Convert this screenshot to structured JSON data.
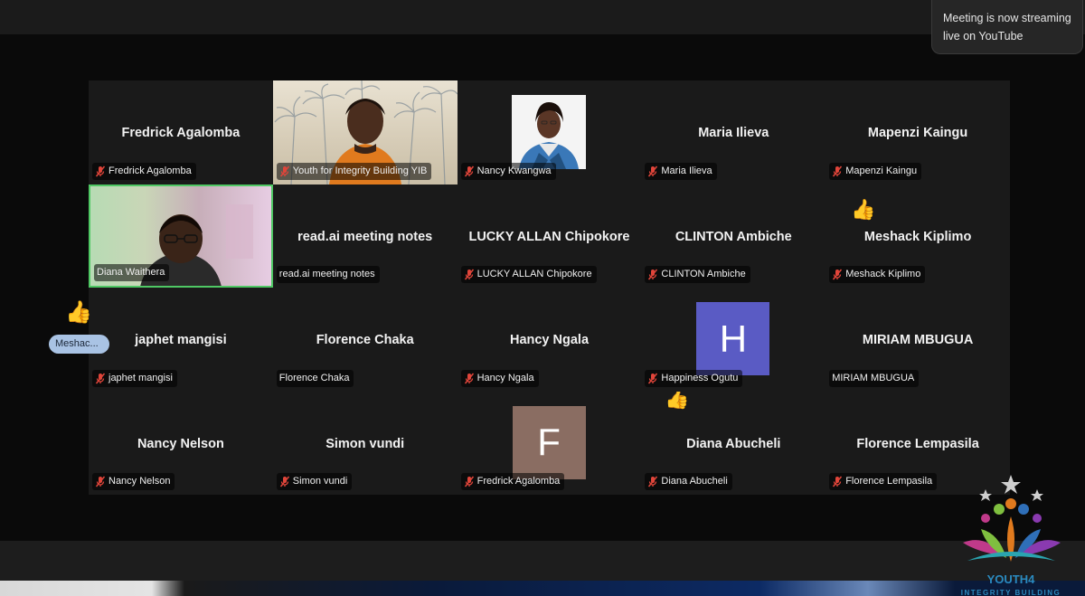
{
  "toast": {
    "line1": "Meeting is now streaming",
    "line2": "live on YouTube"
  },
  "side_participant": {
    "reaction": "👍",
    "name": "Meshac..."
  },
  "tiles": [
    {
      "center": "Fredrick Agalomba",
      "label": "Fredrick Agalomba",
      "muted": true
    },
    {
      "center": "",
      "label": "Youth for Integrity Building YIB",
      "muted": true,
      "video": "youth"
    },
    {
      "center": "",
      "label": "Nancy Kwangwa",
      "muted": true,
      "avatar": "photo"
    },
    {
      "center": "Maria Ilieva",
      "label": "Maria Ilieva",
      "muted": true
    },
    {
      "center": "Mapenzi Kaingu",
      "label": "Mapenzi Kaingu",
      "muted": true
    },
    {
      "center": "",
      "label": "Diana Waithera",
      "muted": false,
      "video": "diana"
    },
    {
      "center": "read.ai meeting notes",
      "label": "read.ai meeting notes",
      "muted": false
    },
    {
      "center": "LUCKY ALLAN Chipokore",
      "label": "LUCKY ALLAN Chipokore",
      "muted": true
    },
    {
      "center": "CLINTON Ambiche",
      "label": "CLINTON Ambiche",
      "muted": true
    },
    {
      "center": "Meshack Kiplimo",
      "label": "Meshack Kiplimo",
      "muted": true,
      "reaction": "👍"
    },
    {
      "center": "japhet mangisi",
      "label": "japhet mangisi",
      "muted": true
    },
    {
      "center": "Florence Chaka",
      "label": "Florence Chaka",
      "muted": false
    },
    {
      "center": "Hancy Ngala",
      "label": "Hancy Ngala",
      "muted": true
    },
    {
      "center": "",
      "label": "Happiness Ogutu",
      "muted": true,
      "letter": "H",
      "letter_color": "#5a5bc4"
    },
    {
      "center": "MIRIAM MBUGUA",
      "label": "MIRIAM MBUGUA",
      "muted": false
    },
    {
      "center": "Nancy Nelson",
      "label": "Nancy Nelson",
      "muted": true
    },
    {
      "center": "Simon vundi",
      "label": "Simon vundi",
      "muted": true
    },
    {
      "center": "",
      "label": "Fredrick Agalomba",
      "muted": true,
      "letter": "F",
      "letter_color": "#8a6d62"
    },
    {
      "center": "Diana Abucheli",
      "label": "Diana Abucheli",
      "muted": true,
      "reaction": "👍"
    },
    {
      "center": "Florence Lempasila",
      "label": "Florence Lempasila",
      "muted": true
    }
  ],
  "logo": {
    "line1": "YOUTH4",
    "line2": "INTEGRITY BUILDING"
  },
  "colors": {
    "muted_icon": "#e0453a",
    "active_speaker": "#4fc864",
    "tile_bg": "#1a1a1a"
  }
}
